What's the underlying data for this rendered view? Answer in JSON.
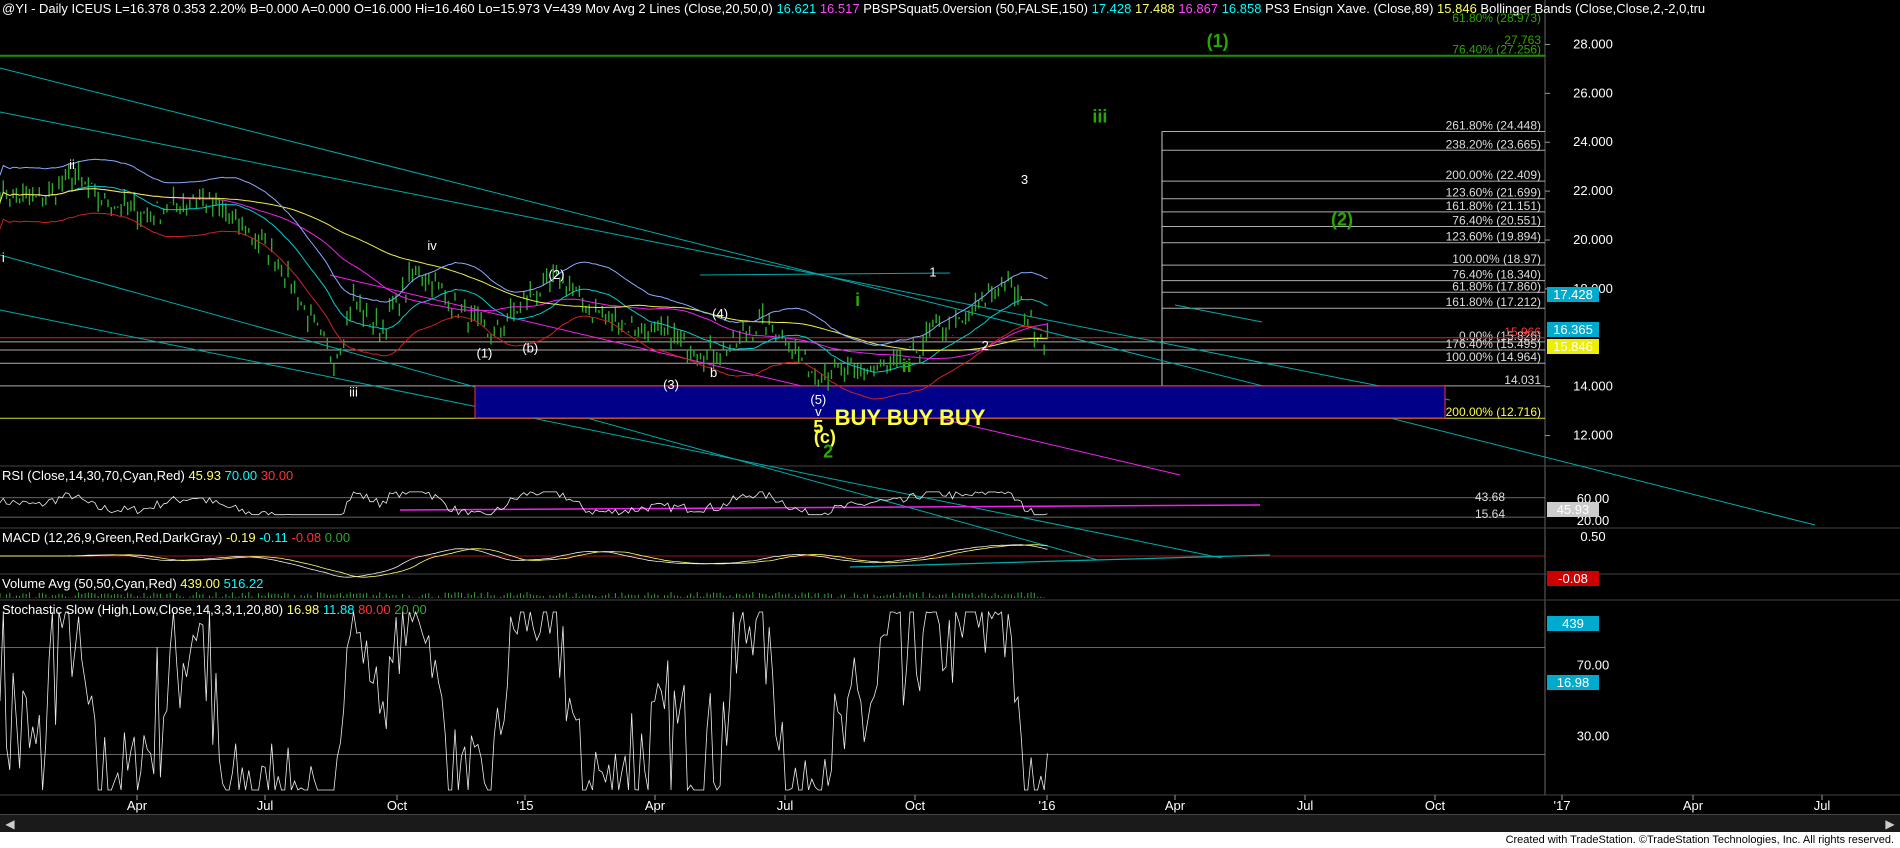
{
  "header": {
    "parts": [
      {
        "t": "@YI - Daily  ICEUS",
        "c": "#ffffff"
      },
      {
        "t": "L=16.378",
        "c": "#ffffff"
      },
      {
        "t": "0.353",
        "c": "#ffffff"
      },
      {
        "t": "2.20%",
        "c": "#ffffff"
      },
      {
        "t": "B=0.000",
        "c": "#ffffff"
      },
      {
        "t": "A=0.000",
        "c": "#ffffff"
      },
      {
        "t": "O=16.000",
        "c": "#ffffff"
      },
      {
        "t": "Hi=16.460",
        "c": "#ffffff"
      },
      {
        "t": "Lo=15.973",
        "c": "#ffffff"
      },
      {
        "t": "V=439",
        "c": "#ffffff"
      },
      {
        "t": "Mov Avg 2 Lines (Close,20,50,0)",
        "c": "#ffffff"
      },
      {
        "t": "16.621",
        "c": "#00ffff"
      },
      {
        "t": "16.517",
        "c": "#ff44ff"
      },
      {
        "t": "PBSPSquat5.0version (50,FALSE,150)",
        "c": "#ffffff"
      },
      {
        "t": "17.428",
        "c": "#00ffff"
      },
      {
        "t": "17.488",
        "c": "#ffff66"
      },
      {
        "t": "16.867",
        "c": "#ff44ff"
      },
      {
        "t": "16.858",
        "c": "#00ffff"
      },
      {
        "t": "PS3 Ensign Xave. (Close,89)",
        "c": "#ffffff"
      },
      {
        "t": "15.846",
        "c": "#ffff66"
      },
      {
        "t": "Bollinger Bands (Close,Close,2,-2,0,tru",
        "c": "#ffffff"
      }
    ]
  },
  "chart_data": [
    {
      "type": "candlestick",
      "title": "@YI - Daily ICEUS",
      "last": 16.378,
      "change": 0.353,
      "change_pct": "2.20%",
      "open": 16.0,
      "high": 16.46,
      "low": 15.973,
      "volume": 439,
      "ylim": [
        11.0,
        29.0
      ],
      "y_ticks": [
        "28.000",
        "26.000",
        "24.000",
        "22.000",
        "20.000",
        "18.000",
        "14.000",
        "12.000"
      ],
      "x_ticks": [
        "Apr",
        "Jul",
        "Oct",
        "'15",
        "Apr",
        "Jul",
        "Oct",
        "'16",
        "Apr",
        "Jul",
        "Oct",
        "'17",
        "Apr",
        "Jul"
      ],
      "price_path": [
        [
          0,
          22.0
        ],
        [
          12,
          21.6
        ],
        [
          22,
          22.7
        ],
        [
          30,
          21.7
        ],
        [
          45,
          21.0
        ],
        [
          60,
          21.8
        ],
        [
          72,
          20.8
        ],
        [
          85,
          19.2
        ],
        [
          95,
          16.7
        ],
        [
          102,
          15.0
        ],
        [
          108,
          17.6
        ],
        [
          116,
          16.3
        ],
        [
          128,
          18.9
        ],
        [
          138,
          17.4
        ],
        [
          150,
          16.0
        ],
        [
          162,
          17.8
        ],
        [
          172,
          18.4
        ],
        [
          180,
          17.2
        ],
        [
          192,
          16.5
        ],
        [
          205,
          16.0
        ],
        [
          214,
          15.5
        ],
        [
          220,
          15.3
        ],
        [
          232,
          16.6
        ],
        [
          238,
          16.3
        ],
        [
          248,
          14.7
        ],
        [
          262,
          14.5
        ],
        [
          276,
          14.9
        ],
        [
          286,
          16.4
        ],
        [
          294,
          16.5
        ],
        [
          306,
          18.4
        ],
        [
          310,
          17.8
        ],
        [
          317,
          16.2
        ],
        [
          320,
          16.1
        ]
      ],
      "rulers": [
        {
          "v": 27.54,
          "color": "#2aa800",
          "label": "76.40% (27.256)"
        },
        {
          "v": 24.44,
          "color": "#cccccc",
          "label": "261.80% (24.448)"
        },
        {
          "v": 23.67,
          "color": "#cccccc",
          "label": "238.20% (23.665)"
        },
        {
          "v": 22.41,
          "color": "#cccccc",
          "label": "200.00% (22.409)"
        },
        {
          "v": 21.69,
          "color": "#cccccc",
          "label": "123.60% (21.699)"
        },
        {
          "v": 21.15,
          "color": "#cccccc",
          "label": "161.80% (21.151)"
        },
        {
          "v": 20.55,
          "color": "#cccccc",
          "label": "76.40% (20.551)"
        },
        {
          "v": 19.89,
          "color": "#cccccc",
          "label": "123.60% (19.894)"
        },
        {
          "v": 18.97,
          "color": "#cccccc",
          "label": "100.00% (18.97)"
        },
        {
          "v": 18.34,
          "color": "#cccccc",
          "label": "76.40% (18.340)"
        },
        {
          "v": 17.86,
          "color": "#cccccc",
          "label": "61.80% (17.860)"
        },
        {
          "v": 17.21,
          "color": "#cccccc",
          "label": "161.80% (17.212)"
        },
        {
          "v": 15.83,
          "color": "#cccccc",
          "label": "0.00% (15.826)"
        },
        {
          "v": 15.5,
          "color": "#cccccc",
          "label": "176.40% (15.495)"
        },
        {
          "v": 14.96,
          "color": "#cccccc",
          "label": "100.00% (14.964)"
        },
        {
          "v": 14.03,
          "color": "#cccccc",
          "label": "14.031"
        },
        {
          "v": 12.71,
          "color": "#ffff44",
          "label": "200.00% (12.716)"
        }
      ],
      "red_line": {
        "v": 16.0,
        "label": "15.966"
      },
      "buy_zone": {
        "label": "BUY BUY BUY",
        "y_top": 14.03,
        "y_bottom": 12.72
      },
      "wave_labels": [
        {
          "t": "ii",
          "c": "#ffffff",
          "x": 22,
          "y": 22.9
        },
        {
          "t": "i",
          "c": "#ffffff",
          "x": 1,
          "y": 19.1
        },
        {
          "t": "iv",
          "c": "#ffffff",
          "x": 132,
          "y": 19.6
        },
        {
          "t": "iii",
          "c": "#ffffff",
          "x": 108,
          "y": 13.6
        },
        {
          "t": "(1)",
          "c": "#ffffff",
          "x": 148,
          "y": 15.2
        },
        {
          "t": "(b)",
          "c": "#ffffff",
          "x": 162,
          "y": 15.4
        },
        {
          "t": "(2)",
          "c": "#ffffff",
          "x": 170,
          "y": 18.4
        },
        {
          "t": "(3)",
          "c": "#ffffff",
          "x": 205,
          "y": 13.9
        },
        {
          "t": "(4)",
          "c": "#ffffff",
          "x": 220,
          "y": 16.8
        },
        {
          "t": "b",
          "c": "#ffffff",
          "x": 218,
          "y": 14.4
        },
        {
          "t": "(5)",
          "c": "#ffffff",
          "x": 250,
          "y": 13.3
        },
        {
          "t": "v",
          "c": "#ffffff",
          "x": 250,
          "y": 12.8
        },
        {
          "t": "5",
          "c": "#ffff44",
          "x": 250,
          "y": 12.1
        },
        {
          "t": "(c)",
          "c": "#ffff44",
          "x": 252,
          "y": 11.7
        },
        {
          "t": "2",
          "c": "#2aa800",
          "x": 253,
          "y": 11.1
        },
        {
          "t": "i",
          "c": "#2aa800",
          "x": 262,
          "y": 17.3
        },
        {
          "t": "ii",
          "c": "#2aa800",
          "x": 277,
          "y": 14.6
        },
        {
          "t": "1",
          "c": "#ffffff",
          "x": 285,
          "y": 18.5
        },
        {
          "t": "2",
          "c": "#ffffff",
          "x": 301,
          "y": 15.5
        },
        {
          "t": "3",
          "c": "#ffffff",
          "x": 313,
          "y": 22.3
        },
        {
          "t": "iii",
          "c": "#2aa800",
          "x": 336,
          "y": 24.8
        },
        {
          "t": "(1)",
          "c": "#2aa800",
          "x": 372,
          "y": 27.9
        },
        {
          "t": "(2)",
          "c": "#2aa800",
          "x": 410,
          "y": 20.6
        }
      ],
      "price_tags": [
        {
          "t": "17.428",
          "bg": "#00aacc"
        },
        {
          "t": "16.365",
          "bg": "#00aacc"
        },
        {
          "t": "15.846",
          "bg": "#eeee00"
        }
      ],
      "top_labels": [
        "61.80% (28.973)",
        "27.763"
      ]
    },
    {
      "type": "line",
      "title": "RSI (Close,14,30,70,Cyan,Red)",
      "values_text": [
        "45.93",
        "70.00",
        "30.00"
      ],
      "y_ticks": [
        "60.00",
        "20.00"
      ],
      "right_labels": [
        "43.68",
        "15.64"
      ],
      "last_tag": "45.93"
    },
    {
      "type": "line",
      "title": "MACD (12,26,9,Green,Red,DarkGray)",
      "values_text": [
        "-0.19",
        "-0.11",
        "-0.08",
        "0.00"
      ],
      "y_ticks": [
        "0.50"
      ],
      "last_tag": "-0.08"
    },
    {
      "type": "bar",
      "title": "Volume Avg (50,50,Cyan,Red)",
      "values_text": [
        "439.00",
        "516.22"
      ],
      "last_tag": "439"
    },
    {
      "type": "line",
      "title": "Stochastic Slow (High,Low,Close,14,3,3,1,20,80)",
      "values_text": [
        "16.98",
        "11.88",
        "80.00",
        "20.00"
      ],
      "y_ticks": [
        "70.00",
        "30.00"
      ],
      "last_tag": "16.98"
    }
  ],
  "footer": {
    "text": "Created with TradeStation. ©TradeStation Technologies, Inc. All rights reserved."
  },
  "colors": {
    "background": "#000000",
    "price": "#2ea82e",
    "cyan": "#00cccc",
    "magenta": "#ee22ee",
    "yellow": "#eeee44",
    "red": "#dd2222",
    "green_label": "#2aa800",
    "buy_zone": "#000088"
  }
}
